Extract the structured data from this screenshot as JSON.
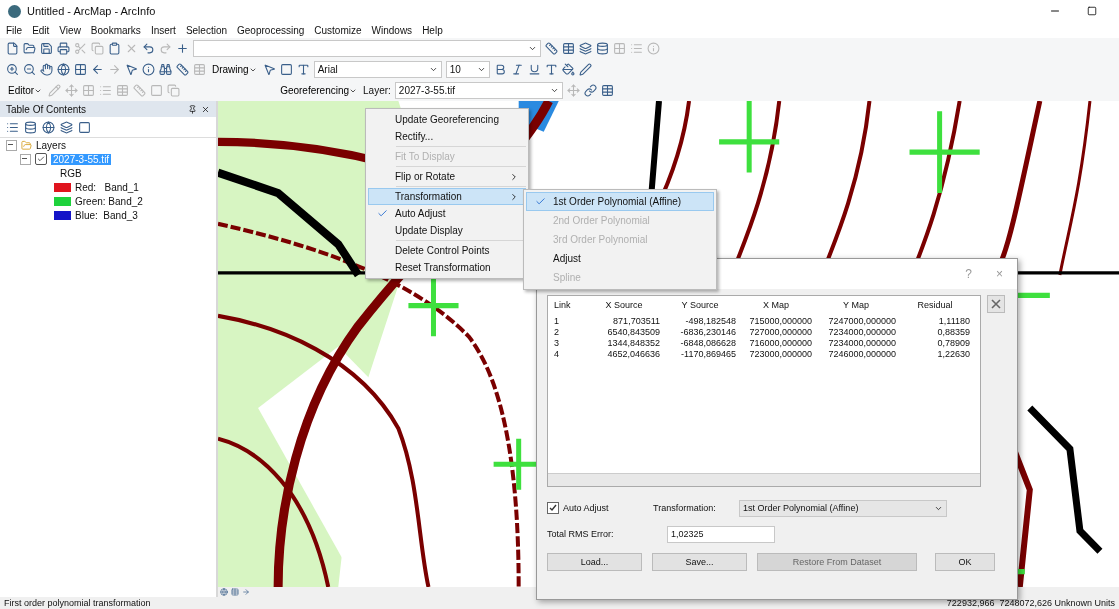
{
  "window": {
    "title": "Untitled - ArcMap - ArcInfo"
  },
  "menu_bar": [
    "File",
    "Edit",
    "View",
    "Bookmarks",
    "Insert",
    "Selection",
    "Geoprocessing",
    "Customize",
    "Windows",
    "Help"
  ],
  "toolbars": {
    "drawing_label": "Drawing",
    "font": "Arial",
    "font_size": "10",
    "editor_label": "Editor",
    "georef_label": "Georeferencing",
    "layer_label": "Layer:",
    "layer_value": "2027-3-55.tif"
  },
  "toc": {
    "title": "Table Of Contents",
    "root": {
      "label": "Layers",
      "expanded": true,
      "children": [
        {
          "label": "2027-3-55.tif",
          "checked": true,
          "selected": true,
          "renderer": "RGB",
          "bands": [
            {
              "label": "Red:   Band_1",
              "color": "#e0141e"
            },
            {
              "label": "Green: Band_2",
              "color": "#1ed23c"
            },
            {
              "label": "Blue:  Band_3",
              "color": "#1414c8"
            }
          ]
        }
      ]
    }
  },
  "georef_menu": {
    "groups": [
      [
        {
          "label": "Update Georeferencing",
          "disabled": false,
          "checked": false,
          "selected": false,
          "submenu": false
        },
        {
          "label": "Rectify...",
          "disabled": false,
          "checked": false,
          "selected": false,
          "submenu": false
        }
      ],
      [
        {
          "label": "Fit To Display",
          "disabled": true,
          "checked": false,
          "selected": false,
          "submenu": false
        }
      ],
      [
        {
          "label": "Flip or Rotate",
          "disabled": false,
          "checked": false,
          "selected": false,
          "submenu": true
        }
      ],
      [
        {
          "label": "Transformation",
          "disabled": false,
          "checked": false,
          "selected": true,
          "submenu": true
        },
        {
          "label": "Auto Adjust",
          "disabled": false,
          "checked": true,
          "selected": false,
          "submenu": false
        },
        {
          "label": "Update Display",
          "disabled": false,
          "checked": false,
          "selected": false,
          "submenu": false
        }
      ],
      [
        {
          "label": "Delete Control Points",
          "disabled": false,
          "checked": false,
          "selected": false,
          "submenu": false
        },
        {
          "label": "Reset Transformation",
          "disabled": false,
          "checked": false,
          "selected": false,
          "submenu": false
        }
      ]
    ]
  },
  "transformation_submenu": [
    {
      "label": "1st Order Polynomial (Affine)",
      "disabled": false,
      "checked": true,
      "selected": true
    },
    {
      "label": "2nd Order Polynomial",
      "disabled": true,
      "checked": false,
      "selected": false
    },
    {
      "label": "3rd Order Polynomial",
      "disabled": true,
      "checked": false,
      "selected": false
    },
    {
      "label": "Adjust",
      "disabled": false,
      "checked": false,
      "selected": false
    },
    {
      "label": "Spline",
      "disabled": true,
      "checked": false,
      "selected": false
    }
  ],
  "link_table_dialog": {
    "help_glyph": "?",
    "close_glyph": "×",
    "columns": [
      "Link",
      "X Source",
      "Y Source",
      "X Map",
      "Y Map",
      "Residual"
    ],
    "rows": [
      [
        "1",
        "871,703511",
        "-498,182548",
        "715000,000000",
        "7247000,000000",
        "1,11180"
      ],
      [
        "2",
        "6540,843509",
        "-6836,230146",
        "727000,000000",
        "7234000,000000",
        "0,88359"
      ],
      [
        "3",
        "1344,848352",
        "-6848,086628",
        "716000,000000",
        "7234000,000000",
        "0,78909"
      ],
      [
        "4",
        "4652,046636",
        "-1170,869465",
        "723000,000000",
        "7246000,000000",
        "1,22630"
      ]
    ],
    "auto_adjust": {
      "label": "Auto Adjust",
      "checked": true
    },
    "transformation_label": "Transformation:",
    "transformation_value": "1st Order Polynomial (Affine)",
    "rms_label": "Total RMS Error:",
    "rms_value": "1,02325",
    "buttons": [
      {
        "label": "Load...",
        "disabled": false
      },
      {
        "label": "Save...",
        "disabled": false
      },
      {
        "label": "Restore From Dataset",
        "disabled": true
      },
      {
        "label": "OK",
        "disabled": false
      }
    ]
  },
  "status_bar": {
    "message": "First order polynomial transformation",
    "coordinates": "722932,966  7248072,626 Unknown Units"
  }
}
